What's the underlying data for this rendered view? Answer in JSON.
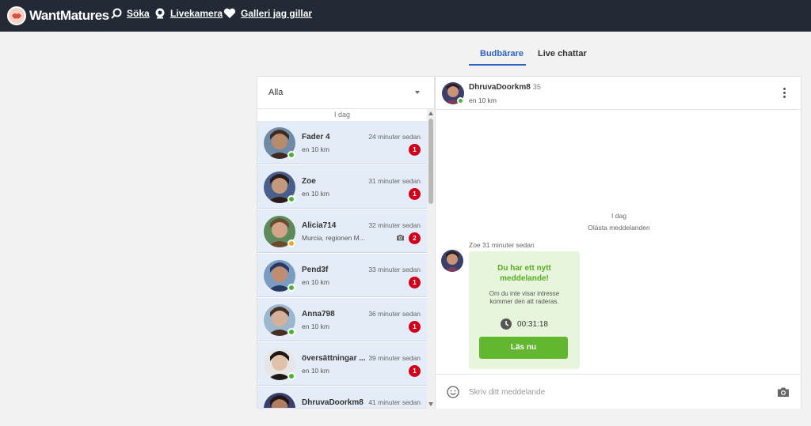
{
  "header": {
    "logo_text": "WantMatures",
    "nav": [
      {
        "label": "Söka",
        "icon": "search-icon"
      },
      {
        "label": "Livekamera",
        "icon": "webcam-icon"
      },
      {
        "label": "Galleri jag gillar",
        "icon": "heart-icon"
      }
    ]
  },
  "tabs": [
    {
      "label": "Budbärare",
      "active": true
    },
    {
      "label": "Live chattar",
      "active": false
    }
  ],
  "filter": {
    "selected": "Alla"
  },
  "list": {
    "day_label": "I dag",
    "conversations": [
      {
        "name": "Fader 4",
        "subtitle": "en 10 km",
        "time": "24 minuter sedan",
        "unread": "1",
        "status_color": "#46b530",
        "has_photo": false
      },
      {
        "name": "Zoe",
        "subtitle": "en 10 km",
        "time": "31 minuter sedan",
        "unread": "1",
        "status_color": "#46b530",
        "has_photo": false
      },
      {
        "name": "Alicia714",
        "subtitle": "Murcia, regionen M...",
        "time": "32 minuter sedan",
        "unread": "2",
        "status_color": "#f5a623",
        "has_photo": true
      },
      {
        "name": "Pend3f",
        "subtitle": "en 10 km",
        "time": "33 minuter sedan",
        "unread": "1",
        "status_color": "#46b530",
        "has_photo": false
      },
      {
        "name": "Anna798",
        "subtitle": "en 10 km",
        "time": "36 minuter sedan",
        "unread": "1",
        "status_color": "#46b530",
        "has_photo": false
      },
      {
        "name": "översättningar ...",
        "subtitle": "en 10 km",
        "time": "39 minuter sedan",
        "unread": "1",
        "status_color": "#46b530",
        "has_photo": false
      },
      {
        "name": "DhruvaDoorkm8",
        "subtitle": "",
        "time": "41 minuter sedan",
        "unread": "",
        "status_color": "#46b530",
        "has_photo": false
      }
    ]
  },
  "chat": {
    "name": "DhruvaDoorkm8",
    "age": "35",
    "distance": "en 10 km",
    "day_label": "I dag",
    "unread_label": "Olästa meddelanden",
    "message": {
      "sender_time": "Zoe 31 minuter sedan",
      "title": "Du har ett nytt meddelande!",
      "description": "Om du inte visar intresse kommer den att raderas.",
      "timer": "00:31:18",
      "button": "Läs nu"
    },
    "composer_placeholder": "Skriv ditt meddelande"
  },
  "colors": {
    "accent": "#2f63c0",
    "topbar": "#232a36",
    "online": "#46b530",
    "unread": "#d0021b",
    "cta": "#63b62f"
  }
}
